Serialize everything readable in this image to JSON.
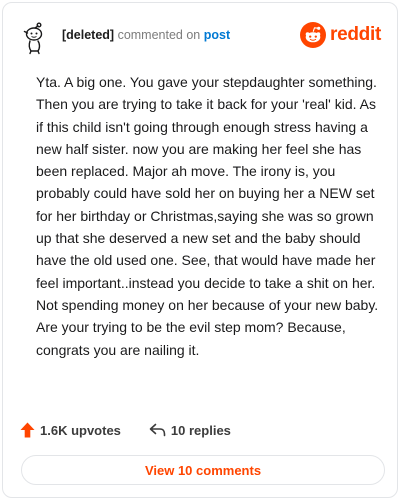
{
  "header": {
    "username": "[deleted]",
    "action_text": " commented on ",
    "post_link": "post",
    "brand_name": "reddit",
    "avatar_icon": "deleted-user-avatar-icon",
    "brand_icon": "reddit-snoo-icon"
  },
  "comment": {
    "text": "Yta. A big one. You gave your stepdaughter something. Then you are trying to take it back for your 'real' kid. As if this child isn't going through enough stress having a new half sister. now you are making her feel she has been replaced. Major ah move. The irony is, you probably could have sold her on buying her a NEW set for her birthday or Christmas,saying she was so grown up that she deserved a new set and the baby should have the old used one. See, that would have made her feel important..instead you decide to take a shit on her. Not spending money on her because of your new baby. Are your trying to be the evil step mom? Because, congrats you are nailing it."
  },
  "actions": {
    "upvotes_label": "1.6K upvotes",
    "upvote_icon": "upvote-arrow-icon",
    "replies_label": "10 replies",
    "reply_icon": "reply-arrow-icon"
  },
  "footer": {
    "view_comments_label": "View 10 comments"
  },
  "colors": {
    "accent": "#ff4500",
    "link": "#0079d3",
    "border": "#e3e5e8",
    "text": "#1a1a1b",
    "muted": "#7c7c7c"
  }
}
